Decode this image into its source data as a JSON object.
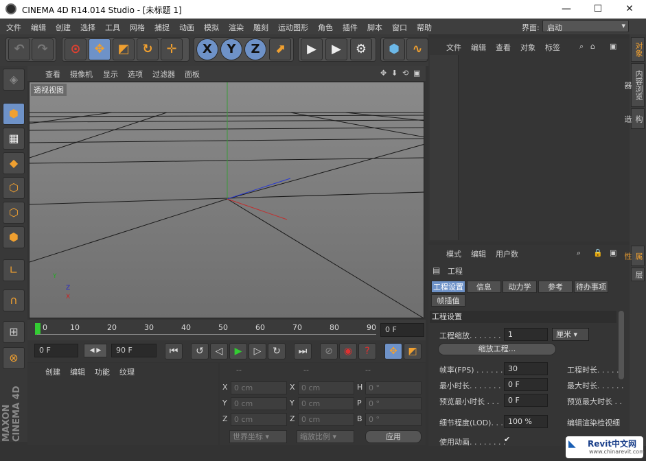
{
  "window": {
    "title": "CINEMA 4D R14.014 Studio - [未标题 1]",
    "minimize": "—",
    "maximize": "☐",
    "close": "✕"
  },
  "menu": {
    "items": [
      "文件",
      "编辑",
      "创建",
      "选择",
      "工具",
      "网格",
      "捕捉",
      "动画",
      "模拟",
      "渲染",
      "雕刻",
      "运动图形",
      "角色",
      "插件",
      "脚本",
      "窗口",
      "帮助"
    ],
    "layout_label": "界面:",
    "layout_value": "启动"
  },
  "viewport": {
    "menu": [
      "查看",
      "摄像机",
      "显示",
      "选项",
      "过滤器",
      "面板"
    ],
    "label": "透视视图",
    "axis_x": "X",
    "axis_y": "Y",
    "axis_z": "Z"
  },
  "timeline": {
    "ticks": [
      "0",
      "10",
      "20",
      "30",
      "40",
      "50",
      "60",
      "70",
      "80",
      "90"
    ],
    "current_frame": "0 F"
  },
  "playback": {
    "start": "0 F",
    "end": "90 F"
  },
  "materials": {
    "menu": [
      "创建",
      "编辑",
      "功能",
      "纹理"
    ]
  },
  "coords": {
    "headers": [
      "--",
      "--",
      "--"
    ],
    "rows": [
      {
        "a": "X",
        "v1": "0 cm",
        "b": "X",
        "v2": "0 cm",
        "c": "H",
        "v3": "0 °"
      },
      {
        "a": "Y",
        "v1": "0 cm",
        "b": "Y",
        "v2": "0 cm",
        "c": "P",
        "v3": "0 °"
      },
      {
        "a": "Z",
        "v1": "0 cm",
        "b": "Z",
        "v2": "0 cm",
        "c": "B",
        "v3": "0 °"
      }
    ],
    "world": "世界坐标",
    "scale": "缩放比例",
    "apply": "应用"
  },
  "objects": {
    "menu": [
      "文件",
      "编辑",
      "查看",
      "对象",
      "标签"
    ]
  },
  "attributes": {
    "menu": [
      "模式",
      "编辑",
      "用户数"
    ],
    "title": "工程",
    "tabs": [
      "工程设置",
      "信息",
      "动力学",
      "参考",
      "待办事项"
    ],
    "tab2": "帧插值",
    "section": "工程设置",
    "scale_label": "工程缩放. . . . . . . .",
    "scale_value": "1",
    "scale_unit": "厘米",
    "scale_button": "缩放工程...",
    "fps_label": "帧率(FPS) . . . . . . .",
    "fps_value": "30",
    "time_label": "工程时长. . . . . .",
    "min_label": "最小时长. . . . . . . .",
    "min_value": "0 F",
    "max_label": "最大时长. . . . . .",
    "pmin_label": "预览最小时长 . . .",
    "pmin_value": "0 F",
    "pmax_label": "预览最大时长 . .",
    "lod_label": "细节程度(LOD). . . .",
    "lod_value": "100 %",
    "render_lod": "编辑渲染检视细",
    "anim_label": "使用动画. . . . . . . .",
    "anim_value": "✔"
  },
  "right_tabs": [
    "对象",
    "内容浏览器",
    "构造"
  ],
  "right_tabs2": [
    "属性",
    "层"
  ],
  "watermark": {
    "brand": "Revit中文网",
    "url": "www.chinarevit.com"
  },
  "maxon": "MAXON CINEMA 4D"
}
